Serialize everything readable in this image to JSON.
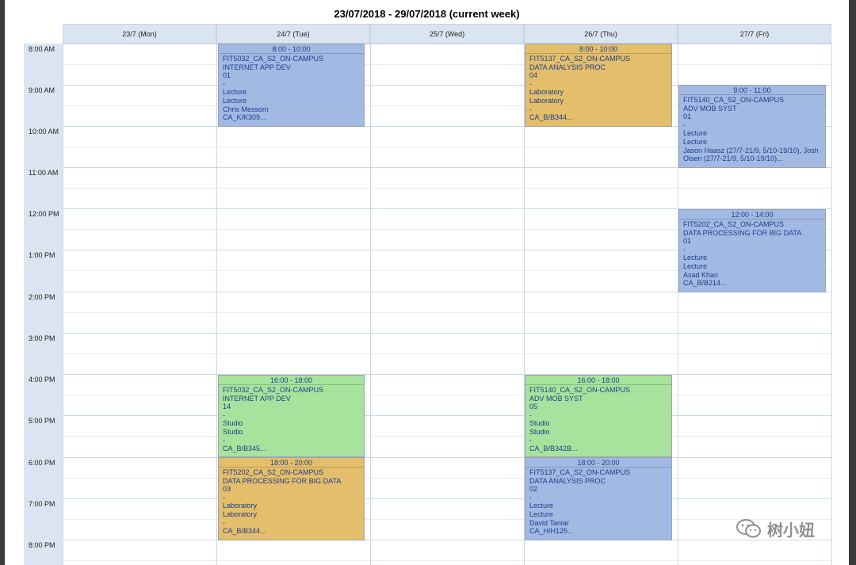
{
  "week_title": "23/07/2018 - 29/07/2018 (current week)",
  "days": [
    {
      "label": "23/7 (Mon)"
    },
    {
      "label": "24/7 (Tue)"
    },
    {
      "label": "25/7 (Wed)"
    },
    {
      "label": "26/7 (Thu)"
    },
    {
      "label": "27/7 (Fri)"
    }
  ],
  "hours": [
    "8:00 AM",
    "9:00 AM",
    "10:00 AM",
    "11:00 AM",
    "12:00 PM",
    "1:00 PM",
    "2:00 PM",
    "3:00 PM",
    "4:00 PM",
    "5:00 PM",
    "6:00 PM",
    "7:00 PM",
    "8:00 PM"
  ],
  "events": [
    {
      "time": "8:00 - 10:00",
      "lines": [
        "FIT5032_CA_S2_ON-CAMPUS",
        "INTERNET APP DEV",
        "01",
        "-",
        "Lecture",
        "Lecture",
        "Chris Messom",
        "CA_K/K309..."
      ]
    },
    {
      "time": "8:00 - 10:00",
      "lines": [
        "FIT5137_CA_S2_ON-CAMPUS",
        "DATA ANALYSIS PROC",
        "04",
        "-",
        "Laboratory",
        "Laboratory",
        "-",
        "CA_B/B344..."
      ]
    },
    {
      "time": "9:00 - 11:00",
      "lines": [
        "FIT5140_CA_S2_ON-CAMPUS",
        "ADV MOB SYST",
        "01",
        "-",
        "Lecture",
        "Lecture",
        "Jason Haasz (27/7-21/9, 5/10-19/10), Josh",
        "Olsen (27/7-21/9, 5/10-19/10)..."
      ]
    },
    {
      "time": "12:00 - 14:00",
      "lines": [
        "FIT5202_CA_S2_ON-CAMPUS",
        "DATA PROCESSING FOR BIG DATA",
        "01",
        "-",
        "Lecture",
        "Lecture",
        "Asad Khan",
        "CA_B/B214..."
      ]
    },
    {
      "time": "16:00 - 18:00",
      "lines": [
        "FIT5032_CA_S2_ON-CAMPUS",
        "INTERNET APP DEV",
        "14",
        "-",
        "Studio",
        "Studio",
        "-",
        "CA_B/B345..."
      ]
    },
    {
      "time": "16:00 - 18:00",
      "lines": [
        "FIT5140_CA_S2_ON-CAMPUS",
        "ADV MOB SYST",
        "05",
        "-",
        "Studio",
        "Studio",
        "-",
        "CA_B/B342B..."
      ]
    },
    {
      "time": "18:00 - 20:00",
      "lines": [
        "FIT5202_CA_S2_ON-CAMPUS",
        "DATA PROCESSING FOR BIG DATA",
        "03",
        "-",
        "Laboratory",
        "Laboratory",
        "-",
        "CA_B/B344..."
      ]
    },
    {
      "time": "18:00 - 20:00",
      "lines": [
        "FIT5137_CA_S2_ON-CAMPUS",
        "DATA ANALYSIS PROC",
        "02",
        "-",
        "Lecture",
        "Lecture",
        "David Taniar",
        "CA_H/H125..."
      ]
    }
  ],
  "colors": {
    "blue": "#a2b9e3",
    "orange": "#e4be6a",
    "green": "#a8e39d",
    "header": "#dbe5f1"
  },
  "watermark": {
    "icon": "wechat-icon",
    "text": "树小妞"
  }
}
